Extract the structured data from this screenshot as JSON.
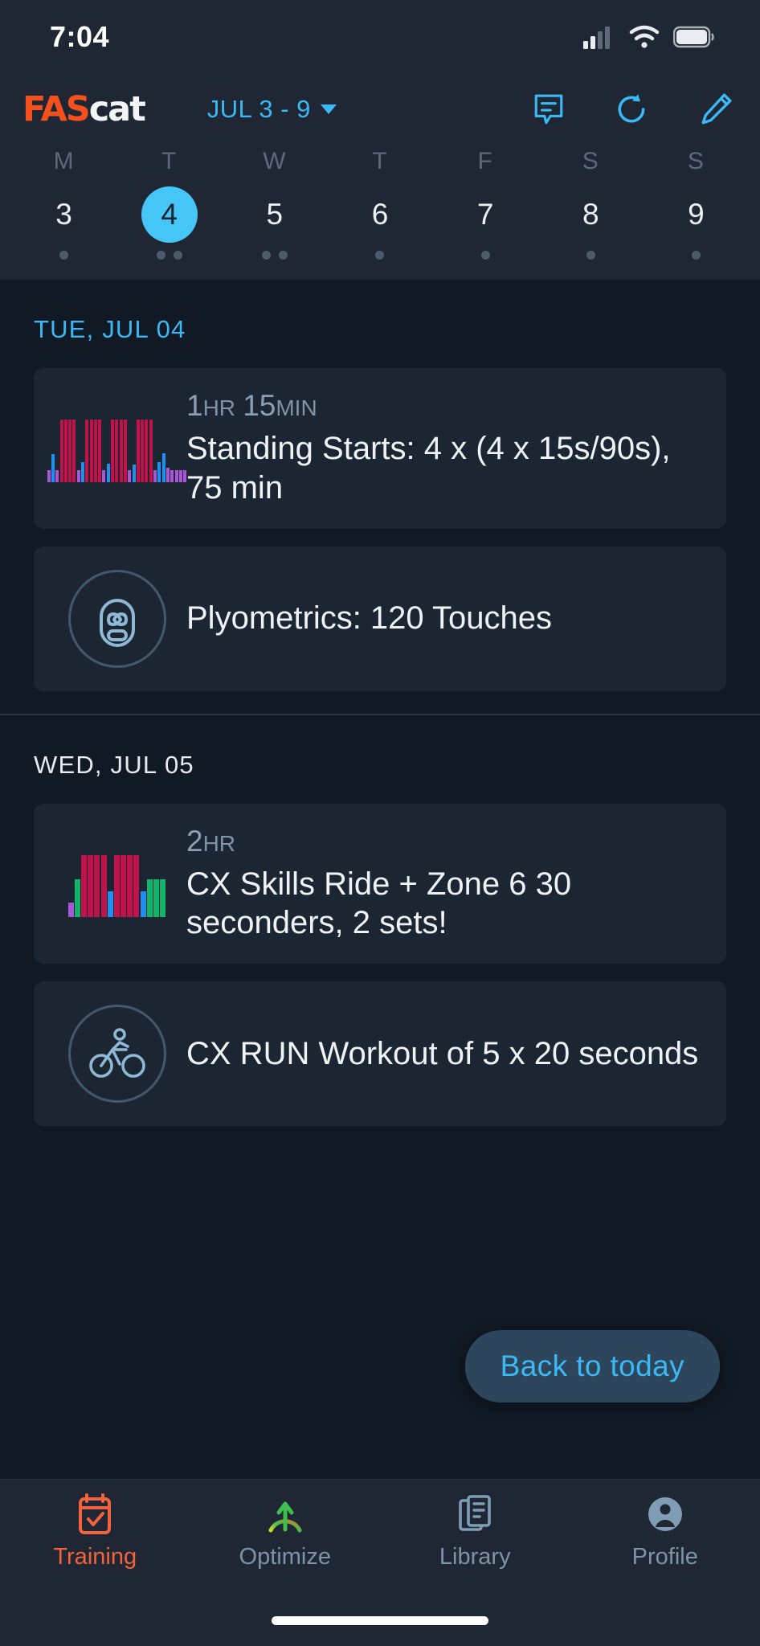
{
  "status": {
    "time": "7:04",
    "icons": [
      "cellular-signal-icon",
      "wifi-icon",
      "battery-icon"
    ]
  },
  "header": {
    "logo_primary": "FAS",
    "logo_secondary": "cat",
    "week_range": "JUL 3 - 9",
    "chevron": "chevron-down-icon",
    "icons": [
      {
        "name": "comment-icon",
        "label": "Comments"
      },
      {
        "name": "refresh-icon",
        "label": "Refresh"
      },
      {
        "name": "edit-pencil-icon",
        "label": "Edit"
      }
    ]
  },
  "calendar": {
    "day_initials": [
      "M",
      "T",
      "W",
      "T",
      "F",
      "S",
      "S"
    ],
    "days": [
      {
        "num": "3",
        "selected": false,
        "dots": 1
      },
      {
        "num": "4",
        "selected": true,
        "dots": 2
      },
      {
        "num": "5",
        "selected": false,
        "dots": 2
      },
      {
        "num": "6",
        "selected": false,
        "dots": 1
      },
      {
        "num": "7",
        "selected": false,
        "dots": 1
      },
      {
        "num": "8",
        "selected": false,
        "dots": 1
      },
      {
        "num": "9",
        "selected": false,
        "dots": 1
      }
    ]
  },
  "sections": [
    {
      "date_label": "TUE, JUL 04",
      "is_today": true,
      "workouts": [
        {
          "icon": "interval-bar-chart-icon",
          "duration_value": "1",
          "duration_unit": "HR",
          "duration_value2": "15",
          "duration_unit2": "MIN",
          "title": "Standing Starts: 4 x (4 x 15s/90s), 75 min"
        },
        {
          "icon": "luchador-mask-icon",
          "duration_value": "",
          "title": "Plyometrics: 120 Touches"
        }
      ]
    },
    {
      "date_label": "WED, JUL 05",
      "is_today": false,
      "workouts": [
        {
          "icon": "cx-bar-chart-icon",
          "duration_value": "2",
          "duration_unit": "HR",
          "title": "CX Skills Ride + Zone 6 30 seconders, 2 sets!"
        },
        {
          "icon": "cyclist-icon",
          "duration_value": "",
          "title": "CX RUN Workout of 5 x 20 seconds"
        }
      ]
    }
  ],
  "back_to_today": {
    "label": "Back to today"
  },
  "tabs": [
    {
      "label": "Training",
      "icon": "calendar-check-icon",
      "active": true
    },
    {
      "label": "Optimize",
      "icon": "arrow-arc-icon",
      "active": false
    },
    {
      "label": "Library",
      "icon": "documents-icon",
      "active": false
    },
    {
      "label": "Profile",
      "icon": "person-circle-icon",
      "active": false
    }
  ],
  "colors": {
    "accent_blue": "#3cb9f5",
    "accent_orange": "#f4501e",
    "bg": "#111924",
    "panel": "#1e2733",
    "card": "#1c2632"
  },
  "chart_data": [
    {
      "type": "bar",
      "title": "Standing Starts interval profile",
      "categories": [
        "1",
        "2",
        "3",
        "4",
        "5",
        "6",
        "7",
        "8",
        "9",
        "10",
        "11",
        "12",
        "13",
        "14",
        "15",
        "16",
        "17",
        "18",
        "19",
        "20",
        "21",
        "22",
        "23",
        "24",
        "25",
        "26",
        "27",
        "28",
        "29",
        "30",
        "31",
        "32",
        "33"
      ],
      "values": [
        18,
        42,
        18,
        95,
        95,
        95,
        95,
        18,
        30,
        95,
        95,
        95,
        95,
        18,
        28,
        95,
        95,
        95,
        95,
        18,
        26,
        95,
        95,
        95,
        95,
        18,
        30,
        44,
        22,
        18,
        18,
        18,
        18
      ],
      "colors": [
        "#a855d8",
        "#1f8ff0",
        "#a855d8",
        "#c0134a",
        "#c0134a",
        "#c0134a",
        "#c0134a",
        "#a855d8",
        "#1f8ff0",
        "#c0134a",
        "#c0134a",
        "#c0134a",
        "#c0134a",
        "#a855d8",
        "#1f8ff0",
        "#c0134a",
        "#c0134a",
        "#c0134a",
        "#c0134a",
        "#a855d8",
        "#1f8ff0",
        "#c0134a",
        "#c0134a",
        "#c0134a",
        "#c0134a",
        "#a855d8",
        "#1f8ff0",
        "#1f8ff0",
        "#a855d8",
        "#a855d8",
        "#a855d8",
        "#a855d8",
        "#a855d8"
      ],
      "xlabel": "",
      "ylabel": "",
      "ylim": [
        0,
        100
      ]
    },
    {
      "type": "bar",
      "title": "CX Skills Ride interval profile",
      "categories": [
        "1",
        "2",
        "3",
        "4",
        "5",
        "6",
        "7",
        "8",
        "9",
        "10",
        "11",
        "12",
        "13",
        "14",
        "15"
      ],
      "values": [
        22,
        58,
        95,
        95,
        95,
        95,
        40,
        95,
        95,
        95,
        95,
        40,
        58,
        58,
        58
      ],
      "colors": [
        "#a855d8",
        "#13b36a",
        "#c0134a",
        "#c0134a",
        "#c0134a",
        "#c0134a",
        "#1f8ff0",
        "#c0134a",
        "#c0134a",
        "#c0134a",
        "#c0134a",
        "#1f8ff0",
        "#13b36a",
        "#13b36a",
        "#13b36a"
      ],
      "xlabel": "",
      "ylabel": "",
      "ylim": [
        0,
        100
      ]
    }
  ]
}
